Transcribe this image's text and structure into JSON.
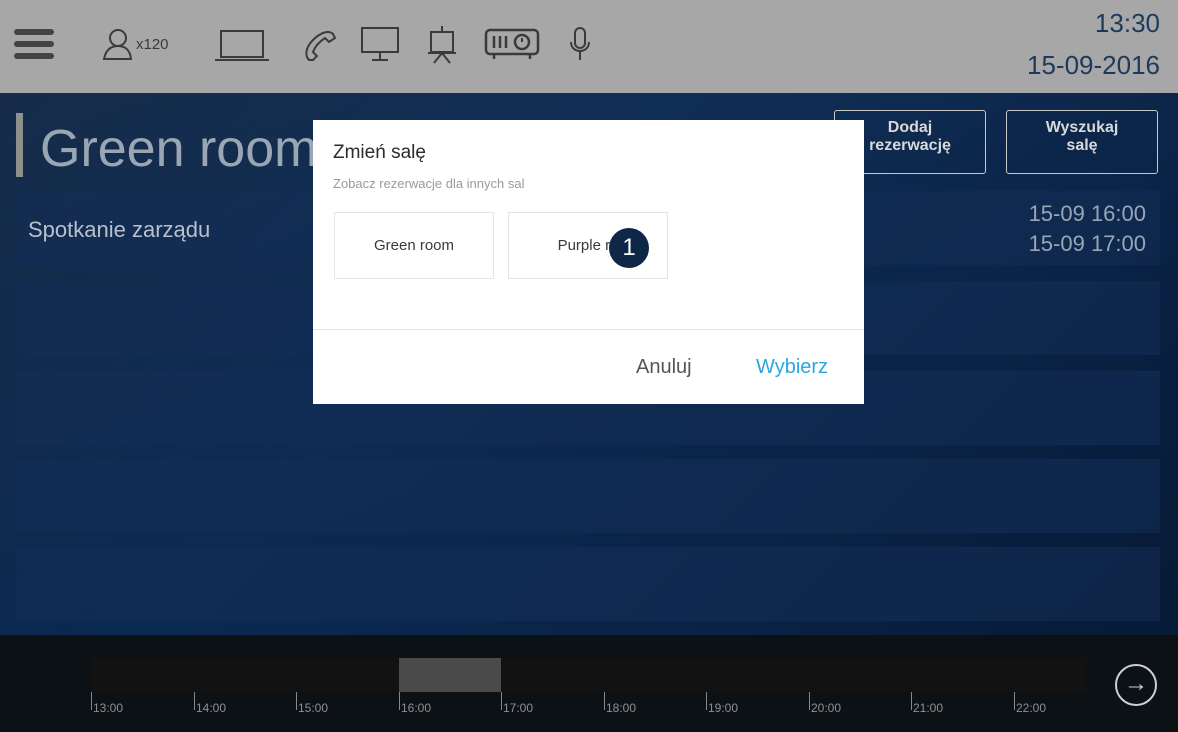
{
  "header": {
    "capacity": "x120",
    "time": "13:30",
    "date": "15-09-2016",
    "icons": [
      "menu-icon",
      "person-icon",
      "laptop-icon",
      "phone-icon",
      "monitor-icon",
      "flipchart-icon",
      "projector-icon",
      "microphone-icon"
    ]
  },
  "room": {
    "title": "Green room",
    "add_button": "Dodaj\nrezerwację",
    "search_button": "Wyszukaj\nsalę"
  },
  "meeting": {
    "title": "Spotkanie zarządu",
    "start": "15-09 16:00",
    "end": "15-09 17:00"
  },
  "timeline": {
    "ticks": [
      "13:00",
      "14:00",
      "15:00",
      "16:00",
      "17:00",
      "18:00",
      "19:00",
      "20:00",
      "21:00",
      "22:00"
    ],
    "booked_from": "16:00",
    "booked_to": "17:00"
  },
  "modal": {
    "title": "Zmień salę",
    "subtitle": "Zobacz rezerwacje dla innych sal",
    "rooms": [
      "Green room",
      "Purple ro"
    ],
    "badge": "1",
    "cancel_label": "Anuluj",
    "select_label": "Wybierz"
  },
  "colors": {
    "accent": "#29a8e0",
    "header_bg": "#a7a7a7",
    "badge_bg": "#0f2747"
  }
}
